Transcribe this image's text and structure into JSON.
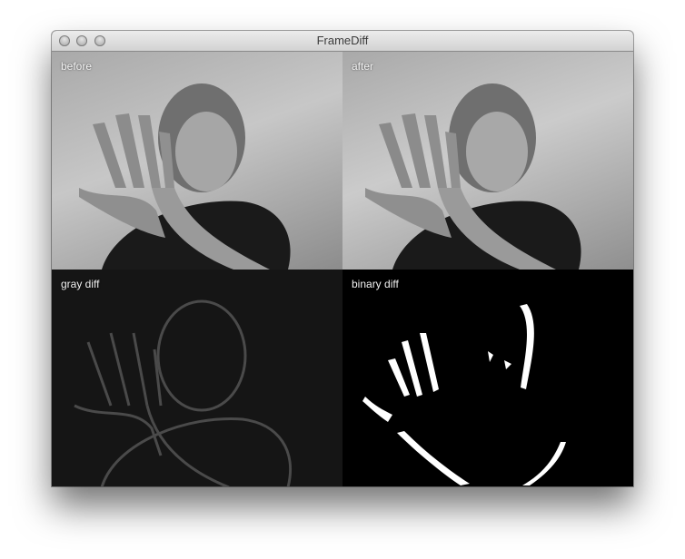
{
  "window": {
    "title": "FrameDiff"
  },
  "panes": {
    "before": {
      "label": "before"
    },
    "after": {
      "label": "after"
    },
    "gray_diff": {
      "label": "gray diff"
    },
    "binary_diff": {
      "label": "binary diff"
    }
  }
}
